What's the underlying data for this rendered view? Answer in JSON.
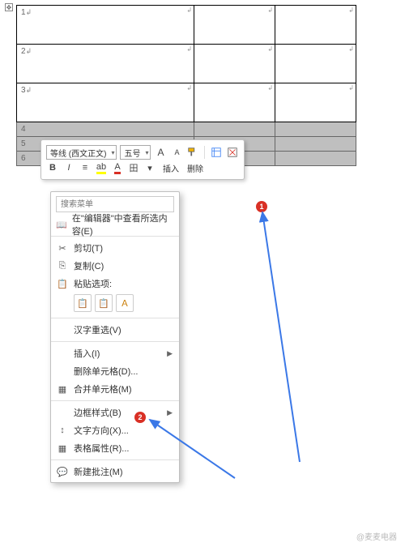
{
  "table": {
    "rows": [
      "1",
      "2",
      "3",
      "4",
      "5",
      "6"
    ]
  },
  "mini_toolbar": {
    "font": "等线 (西文正文)",
    "size": "五号",
    "increase": "A",
    "decrease": "A",
    "format_painter": "格",
    "styles": "式",
    "bold": "B",
    "italic": "I",
    "align": "≡",
    "highlight": "ab",
    "font_color": "A",
    "border": "田",
    "line": "—",
    "insert": "插入",
    "delete": "删除"
  },
  "context_menu": {
    "search_placeholder": "搜索菜单",
    "editor_lookup": "在\"编辑器\"中查看所选内容(E)",
    "cut": "剪切(T)",
    "copy": "复制(C)",
    "paste_options": "粘贴选项:",
    "han": "汉字重选(V)",
    "insert": "插入(I)",
    "delete_cells": "删除单元格(D)...",
    "merge": "合并单元格(M)",
    "border_style": "边框样式(B)",
    "text_dir": "文字方向(X)...",
    "table_props": "表格属性(R)...",
    "new_comment": "新建批注(M)"
  },
  "badges": {
    "b1": "1",
    "b2": "2"
  },
  "watermark": "@麦麦电器"
}
